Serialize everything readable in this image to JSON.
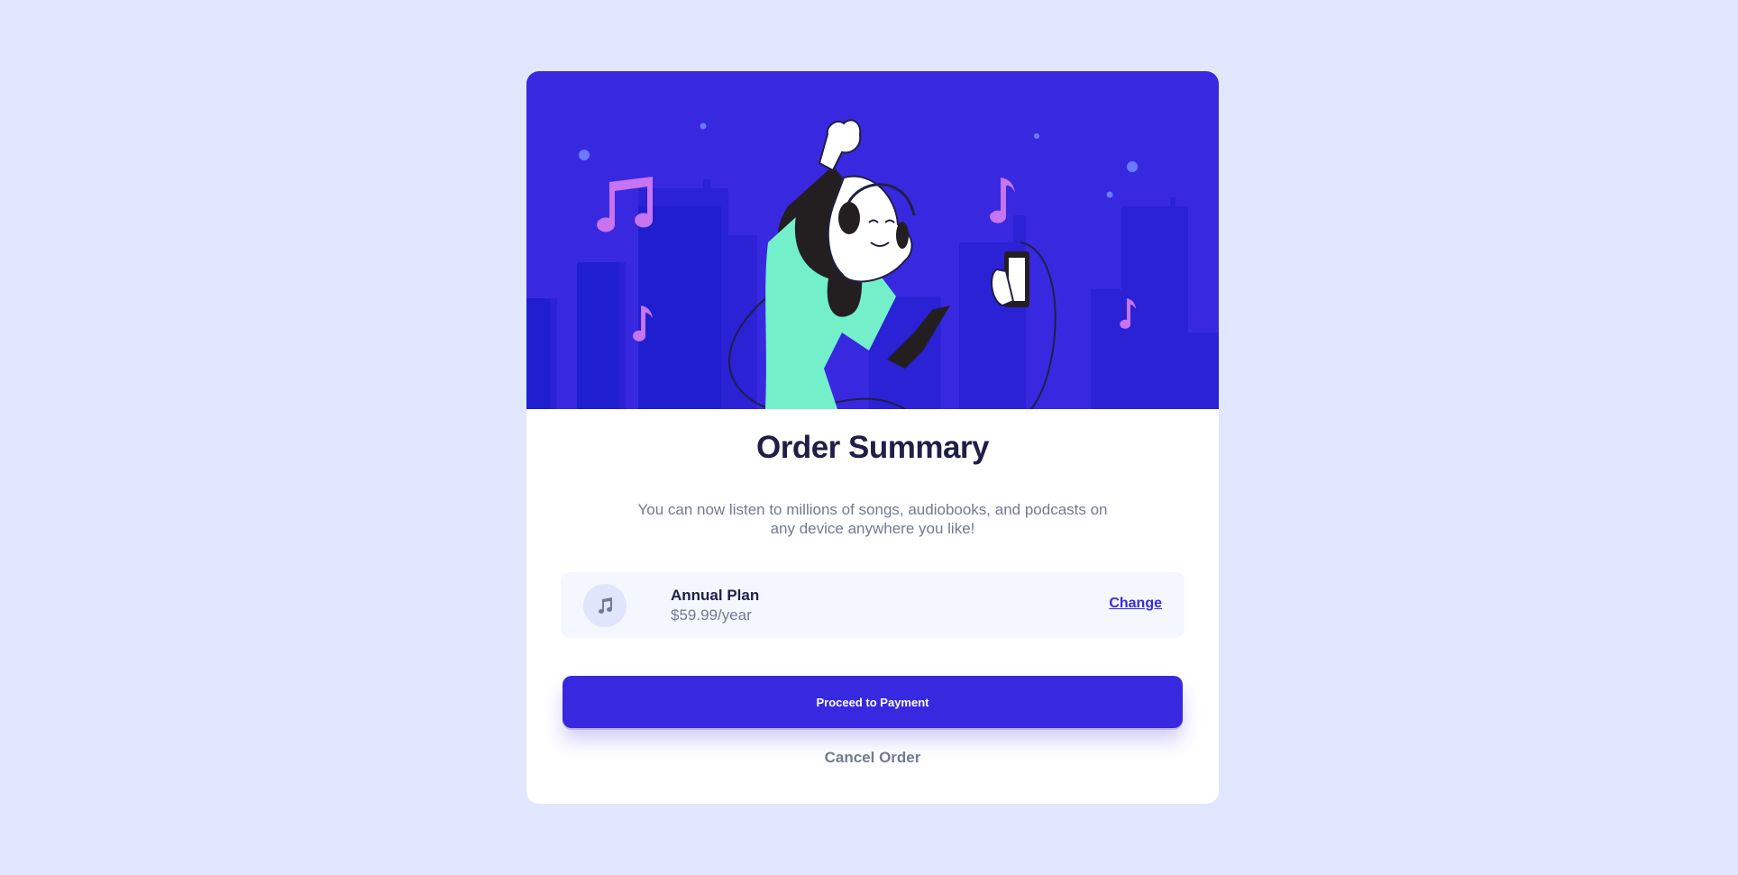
{
  "card": {
    "title": "Order Summary",
    "description": "You can now listen to millions of songs, audiobooks, and podcasts on any device anywhere you like!",
    "plan": {
      "icon": "music-note-icon",
      "name": "Annual Plan",
      "price": "$59.99/year",
      "change_label": "Change"
    },
    "primary_button": "Proceed to Payment",
    "secondary_button": "Cancel Order"
  },
  "colors": {
    "page_background": "#e0e7ff",
    "accent": "#3829e0",
    "heading": "#1f1f47",
    "muted_text": "#717a92",
    "plan_background": "#f5f7ff"
  }
}
